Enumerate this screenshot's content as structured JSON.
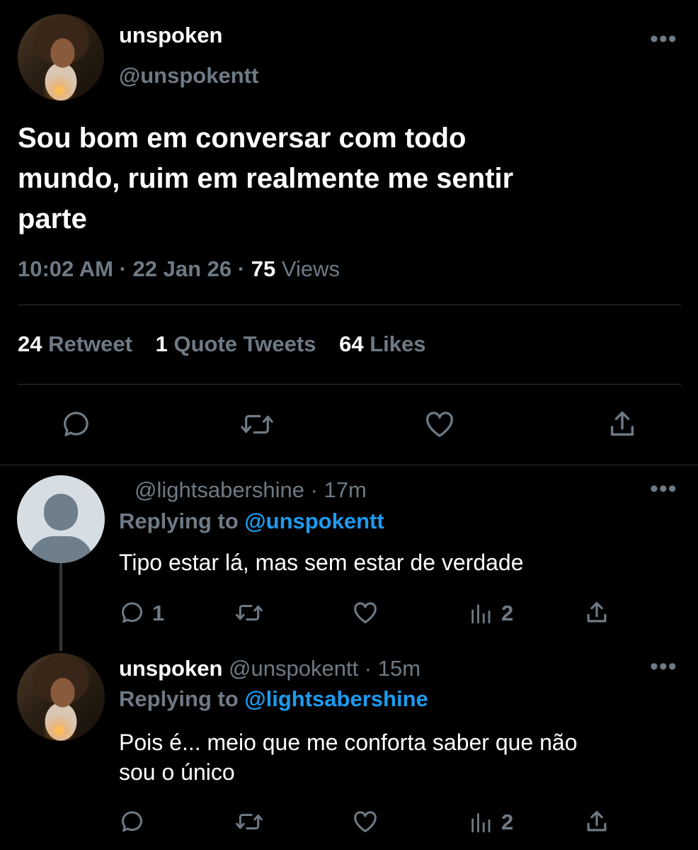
{
  "main_tweet": {
    "display_name": "unspoken",
    "handle": "@unspokentt",
    "text_lines": [
      "Sou bom em conversar com todo",
      "mundo, ruim em realmente me sentir",
      "parte"
    ],
    "time": "10:02 AM",
    "separator": "·",
    "date": "22 Jan 26",
    "views_count": "75",
    "views_label": "Views",
    "retweets_count": "24",
    "retweets_label": "Retweet",
    "quotes_count": "1",
    "quotes_label": "Quote Tweets",
    "likes_count": "64",
    "likes_label": "Likes"
  },
  "replies": [
    {
      "handle": "@lightsabershine",
      "separator": "·",
      "time": "17m",
      "replying_label": "Replying to",
      "replying_to": "@unspokentt",
      "text_lines": [
        "Tipo estar lá, mas sem estar de verdade"
      ],
      "reply_count": "1",
      "views_count": "2"
    },
    {
      "display_name": "unspoken",
      "handle": "@unspokentt",
      "separator": "·",
      "time": "15m",
      "replying_label": "Replying to",
      "replying_to": "@lightsabershine",
      "text_lines": [
        "Pois é... meio que me conforta saber que não",
        "sou o único"
      ],
      "views_count": "2"
    }
  ],
  "icons": {
    "more": "more-horizontal-icon",
    "reply": "speech-bubble-icon",
    "retweet": "retweet-arrows-icon",
    "like": "heart-outline-icon",
    "share": "share-up-arrow-icon",
    "analytics": "bar-chart-icon"
  },
  "colors": {
    "background": "#000000",
    "text": "#ffffff",
    "muted": "#6e7a85",
    "link": "#1d9bf0",
    "divider": "#2f3336"
  }
}
